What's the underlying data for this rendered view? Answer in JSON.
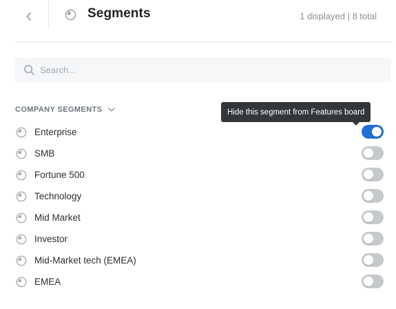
{
  "header": {
    "title": "Segments",
    "counts": "1 displayed | 8 total",
    "back_icon": "chevron-left-icon",
    "title_icon": "segment-pie-icon"
  },
  "search": {
    "placeholder": "Search...",
    "value": ""
  },
  "section": {
    "title": "COMPANY SEGMENTS",
    "expanded": true
  },
  "tooltip": {
    "text": "Hide this segment from Features board"
  },
  "segments": [
    {
      "label": "Enterprise",
      "enabled": true
    },
    {
      "label": "SMB",
      "enabled": false
    },
    {
      "label": "Fortune 500",
      "enabled": false
    },
    {
      "label": "Technology",
      "enabled": false
    },
    {
      "label": "Mid Market",
      "enabled": false
    },
    {
      "label": "Investor",
      "enabled": false
    },
    {
      "label": "Mid-Market tech (EMEA)",
      "enabled": false
    },
    {
      "label": "EMEA",
      "enabled": false
    }
  ],
  "colors": {
    "accent": "#1f6fd6",
    "toggle_off": "#c6cacf",
    "tooltip_bg": "#33363a"
  }
}
